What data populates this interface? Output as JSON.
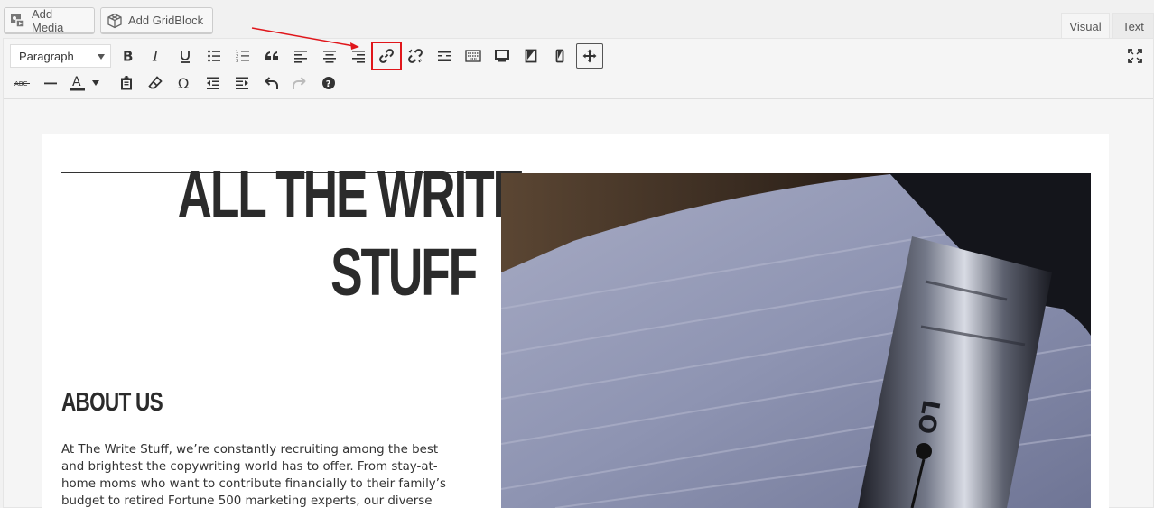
{
  "media_buttons": {
    "add_media": "Add Media",
    "add_gridblock": "Add GridBlock"
  },
  "tabs": {
    "visual": "Visual",
    "text": "Text"
  },
  "toolbar": {
    "format_select": "Paragraph",
    "row1_icons": [
      "bold-icon",
      "italic-icon",
      "underline-icon",
      "bullet-list-icon",
      "numbered-list-icon",
      "blockquote-icon",
      "align-left-icon",
      "align-center-icon",
      "align-right-icon",
      "insert-link-icon",
      "remove-link-icon",
      "read-more-icon",
      "toolbar-toggle-icon",
      "desktop-icon",
      "tablet-icon",
      "mobile-icon",
      "move-icon",
      "fullscreen-icon"
    ],
    "row2_icons": [
      "strikethrough-icon",
      "horizontal-line-icon",
      "text-color-icon",
      "paste-as-text-icon",
      "clear-formatting-icon",
      "special-character-icon",
      "outdent-icon",
      "indent-icon",
      "undo-icon",
      "redo-icon",
      "help-icon"
    ],
    "highlight_color": "#e0161b"
  },
  "content": {
    "headline_line1": "ALL THE WRITE",
    "headline_line2": "STUFF",
    "section_title": "ABOUT US",
    "body": "At The Write Stuff, we’re constantly recruiting among the best and brightest the copywriting world has to offer. From stay-at-home moms who want to contribute financially to their family’s budget to retired Fortune 500 marketing experts, our diverse team allows us to"
  }
}
